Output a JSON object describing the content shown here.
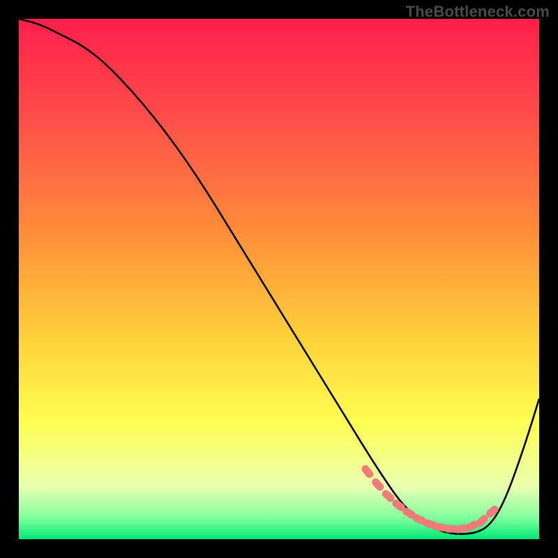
{
  "watermark": "TheBottleneck.com",
  "chart_data": {
    "type": "line",
    "title": "",
    "xlabel": "",
    "ylabel": "",
    "xlim": [
      0,
      100
    ],
    "ylim": [
      0,
      100
    ],
    "gradient_stops": [
      {
        "offset": 0,
        "color": "#ff1f4b"
      },
      {
        "offset": 18,
        "color": "#ff4b4b"
      },
      {
        "offset": 40,
        "color": "#ff8a3a"
      },
      {
        "offset": 62,
        "color": "#ffd33a"
      },
      {
        "offset": 78,
        "color": "#ffff55"
      },
      {
        "offset": 90,
        "color": "#e9ffb0"
      },
      {
        "offset": 96,
        "color": "#7fff9e"
      },
      {
        "offset": 100,
        "color": "#00e874"
      }
    ],
    "series": [
      {
        "name": "bottleneck-curve",
        "x": [
          0,
          4,
          8,
          12,
          16,
          20,
          24,
          28,
          32,
          36,
          40,
          44,
          48,
          52,
          56,
          60,
          64,
          68,
          72,
          74,
          76,
          78,
          80,
          82,
          84,
          86,
          88,
          90,
          92,
          94,
          96,
          98,
          100
        ],
        "y": [
          100,
          99,
          97,
          95,
          92,
          88,
          83.5,
          78.5,
          73,
          67,
          60.5,
          54,
          47.5,
          41,
          34.5,
          28,
          21.5,
          15,
          9,
          6.5,
          4.5,
          3,
          2,
          1.3,
          1,
          1,
          1.3,
          2.3,
          4.8,
          9,
          14.5,
          20.5,
          27
        ]
      }
    ],
    "marker_band": {
      "name": "optimal-range",
      "x": [
        67,
        69,
        71,
        73,
        75,
        77,
        79,
        81,
        83,
        85,
        87,
        89,
        91
      ],
      "y": [
        13,
        10.5,
        8.3,
        6.5,
        5,
        3.8,
        2.9,
        2.3,
        2,
        2,
        2.5,
        3.5,
        5.3
      ]
    }
  }
}
